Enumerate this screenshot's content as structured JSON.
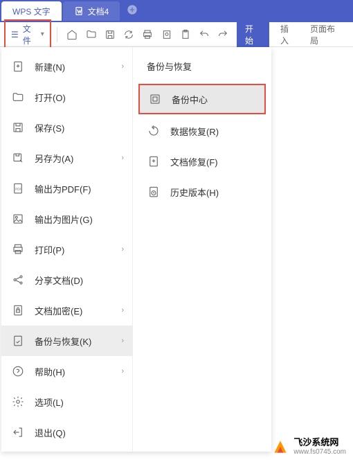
{
  "tabs": {
    "active": "WPS 文字",
    "inactive": "文档4"
  },
  "file_btn": {
    "label": "文件",
    "hamburger": "☰"
  },
  "ribbon": {
    "start": "开始",
    "insert": "插入",
    "layout": "页面布局"
  },
  "menu": {
    "new": "新建(N)",
    "open": "打开(O)",
    "save": "保存(S)",
    "saveas": "另存为(A)",
    "pdf": "输出为PDF(F)",
    "image": "输出为图片(G)",
    "print": "打印(P)",
    "share": "分享文档(D)",
    "encrypt": "文档加密(E)",
    "backup": "备份与恢复(K)",
    "help": "帮助(H)",
    "options": "选项(L)",
    "exit": "退出(Q)"
  },
  "submenu": {
    "header": "备份与恢复",
    "backup_center": "备份中心",
    "data_recovery": "数据恢复(R)",
    "doc_repair": "文档修复(F)",
    "history": "历史版本(H)"
  },
  "watermark": {
    "title": "飞沙系统网",
    "url": "www.fs0745.com"
  },
  "arrow": "›"
}
